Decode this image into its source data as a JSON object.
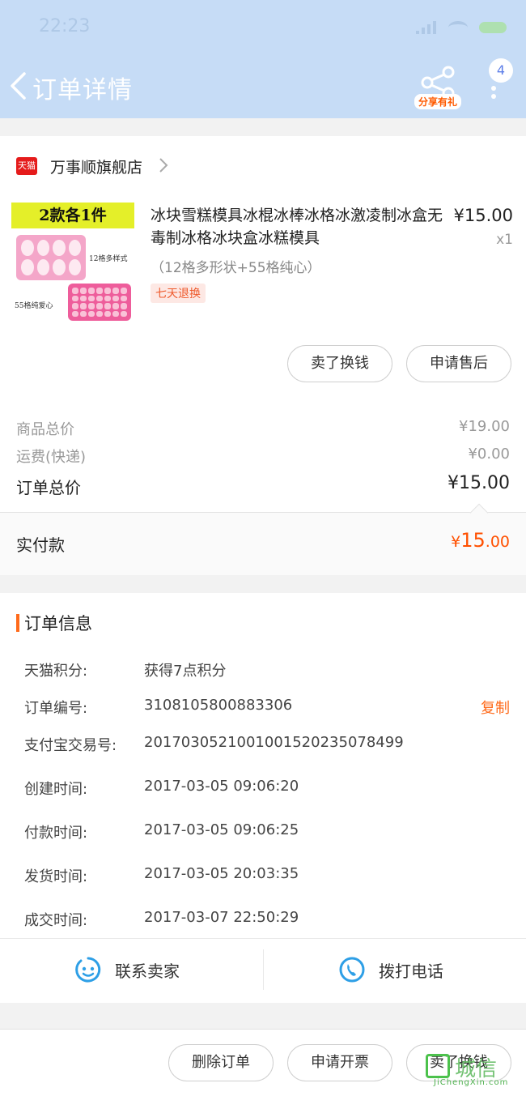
{
  "status_bar": {
    "time": "22:23"
  },
  "header": {
    "title": "订单详情",
    "share_tag": "分享有礼",
    "badge_count": "4"
  },
  "shop": {
    "logo_text": "天猫",
    "name": "万事顺旗舰店"
  },
  "product": {
    "thumb_banner": "2款各1件",
    "thumb_text_1": "12格多样式",
    "thumb_text_2": "55格纯爱心",
    "name": "冰块雪糕模具冰棍冰棒冰格冰激凌制冰盒无毒制冰格冰块盒冰糕模具",
    "price": "¥15.00",
    "qty": "x1",
    "sku": "（12格多形状+55格纯心）",
    "service_tag": "七天退换"
  },
  "item_actions": {
    "sell": "卖了换钱",
    "after_sale": "申请售后"
  },
  "prices": [
    {
      "label": "商品总价",
      "value": "¥19.00"
    },
    {
      "label": "运费(快递)",
      "value": "¥0.00"
    },
    {
      "label": "订单总价",
      "value": "¥15.00"
    }
  ],
  "paid": {
    "label": "实付款",
    "currency": "¥",
    "int": "15",
    "dec": ".00"
  },
  "order_info": {
    "title": "订单信息",
    "copy_label": "复制",
    "rows": [
      {
        "label": "天猫积分:",
        "value": "获得7点积分"
      },
      {
        "label": "订单编号:",
        "value": "3108105800883306"
      },
      {
        "label": "支付宝交易号:",
        "value": "2017030521001001520235078499"
      },
      {
        "label": "创建时间:",
        "value": "2017-03-05 09:06:20"
      },
      {
        "label": "付款时间:",
        "value": "2017-03-05 09:06:25"
      },
      {
        "label": "发货时间:",
        "value": "2017-03-05 20:03:35"
      },
      {
        "label": "成交时间:",
        "value": "2017-03-07 22:50:29"
      }
    ],
    "contact_seller": "联系卖家",
    "call_phone": "拨打电话"
  },
  "bottom_actions": {
    "delete": "删除订单",
    "invoice": "申请开票",
    "sell": "卖了换钱"
  },
  "watermark": {
    "text": "城信",
    "sub": "JiChengXin.com"
  },
  "colors": {
    "accent": "#ff5000",
    "header_bg": "#c6dcf6",
    "tag_text": "#ee5a2c",
    "icon_blue": "#2e9fe6"
  }
}
